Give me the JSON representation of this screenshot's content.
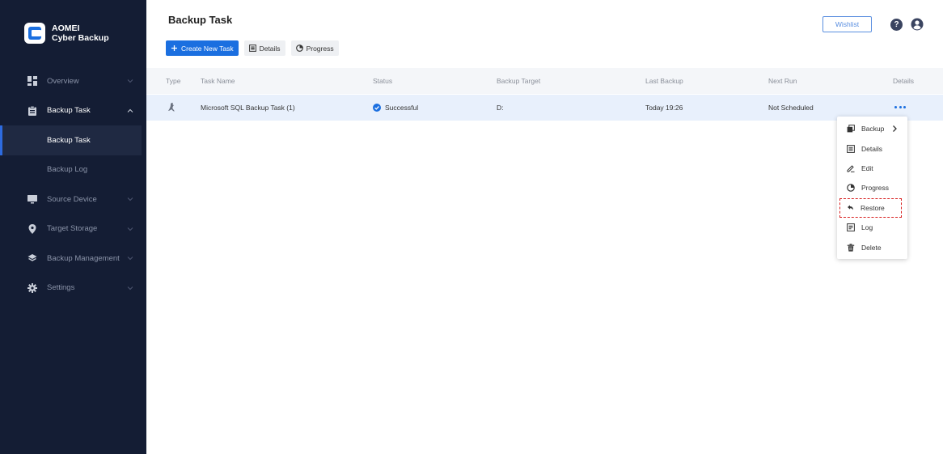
{
  "brand": {
    "line1": "AOMEI",
    "line2": "Cyber Backup"
  },
  "sidebar": {
    "items": [
      {
        "label": "Overview",
        "icon": "dashboard-icon"
      },
      {
        "label": "Backup Task",
        "icon": "clipboard-icon",
        "expanded": true,
        "children": [
          {
            "label": "Backup Task",
            "active": true
          },
          {
            "label": "Backup Log"
          }
        ]
      },
      {
        "label": "Source Device",
        "icon": "monitor-icon"
      },
      {
        "label": "Target Storage",
        "icon": "location-pin-icon"
      },
      {
        "label": "Backup Management",
        "icon": "layers-icon"
      },
      {
        "label": "Settings",
        "icon": "gear-icon"
      }
    ]
  },
  "header": {
    "title": "Backup Task",
    "wishlist": "Wishlist",
    "help": "?"
  },
  "toolbar": {
    "create": "Create New Task",
    "details": "Details",
    "progress": "Progress"
  },
  "table": {
    "columns": [
      "Type",
      "Task Name",
      "Status",
      "Backup Target",
      "Last Backup",
      "Next Run",
      "Details"
    ],
    "rows": [
      {
        "type_icon": "sql-server-icon",
        "task_name": "Microsoft SQL Backup Task (1)",
        "status": "Successful",
        "backup_target": "D:",
        "last_backup": "Today 19:26",
        "next_run": "Not Scheduled"
      }
    ]
  },
  "menu": {
    "items": [
      {
        "label": "Backup",
        "icon": "copy-icon",
        "has_submenu": true
      },
      {
        "label": "Details",
        "icon": "details-icon"
      },
      {
        "label": "Edit",
        "icon": "edit-icon"
      },
      {
        "label": "Progress",
        "icon": "progress-icon"
      },
      {
        "label": "Restore",
        "icon": "restore-icon",
        "highlighted": true
      },
      {
        "label": "Log",
        "icon": "log-icon"
      },
      {
        "label": "Delete",
        "icon": "trash-icon"
      }
    ]
  },
  "colors": {
    "sidebar_bg": "#141d34",
    "accent": "#1b6fe0",
    "success": "#1b6fe0",
    "highlight_border": "#d81e1e",
    "row_selected": "#e8f0fc"
  }
}
